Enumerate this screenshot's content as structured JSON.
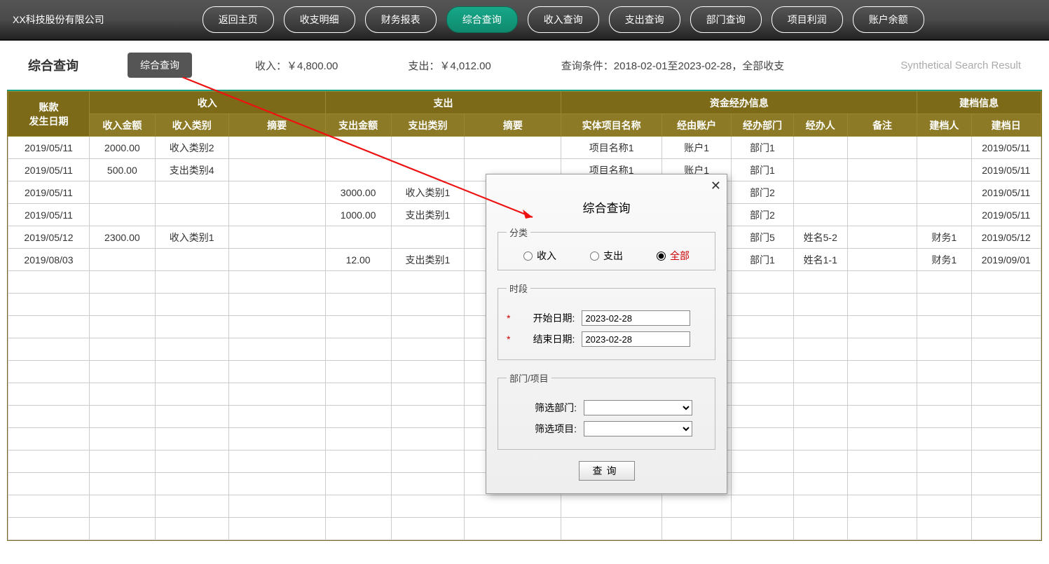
{
  "brand": "XX科技股份有限公司",
  "nav": {
    "items": [
      {
        "label": "返回主页"
      },
      {
        "label": "收支明细"
      },
      {
        "label": "财务报表"
      },
      {
        "label": "综合查询",
        "active": true
      },
      {
        "label": "收入查询"
      },
      {
        "label": "支出查询"
      },
      {
        "label": "部门查询"
      },
      {
        "label": "项目利润"
      },
      {
        "label": "账户余额"
      }
    ]
  },
  "summary": {
    "title": "综合查询",
    "searchBtn": "综合查询",
    "income": "收入：￥4,800.00",
    "expense": "支出：￥4,012.00",
    "condition": "查询条件：2018-02-01至2023-02-28，全部收支",
    "english": "Synthetical Search Result"
  },
  "header": {
    "date": "账款\n发生日期",
    "incomeGrp": "收入",
    "incomeAmt": "收入金额",
    "incomeCat": "收入类别",
    "incomeSum": "摘要",
    "expenseGrp": "支出",
    "expenseAmt": "支出金额",
    "expenseCat": "支出类别",
    "expenseSum": "摘要",
    "fundGrp": "资金经办信息",
    "projName": "实体项目名称",
    "viaAcc": "经由账户",
    "viaDept": "经办部门",
    "viaPerson": "经办人",
    "remark": "备注",
    "createGrp": "建档信息",
    "creator": "建档人",
    "createDate": "建档日"
  },
  "rows": [
    {
      "date": "2019/05/11",
      "inAmt": "2000.00",
      "inCat": "收入类别2",
      "inSum": "",
      "exAmt": "",
      "exCat": "",
      "exSum": "",
      "proj": "项目名称1",
      "acc": "账户1",
      "dept": "部门1",
      "person": "",
      "remark": "",
      "creator": "",
      "cdate": "2019/05/11"
    },
    {
      "date": "2019/05/11",
      "inAmt": "500.00",
      "inCat": "支出类别4",
      "inSum": "",
      "exAmt": "",
      "exCat": "",
      "exSum": "",
      "proj": "项目名称1",
      "acc": "账户1",
      "dept": "部门1",
      "person": "",
      "remark": "",
      "creator": "",
      "cdate": "2019/05/11"
    },
    {
      "date": "2019/05/11",
      "inAmt": "",
      "inCat": "",
      "inSum": "",
      "exAmt": "3000.00",
      "exCat": "收入类别1",
      "exSum": "",
      "proj": "",
      "acc": "",
      "dept": "部门2",
      "person": "",
      "remark": "",
      "creator": "",
      "cdate": "2019/05/11"
    },
    {
      "date": "2019/05/11",
      "inAmt": "",
      "inCat": "",
      "inSum": "",
      "exAmt": "1000.00",
      "exCat": "支出类别1",
      "exSum": "",
      "proj": "",
      "acc": "",
      "dept": "部门2",
      "person": "",
      "remark": "",
      "creator": "",
      "cdate": "2019/05/11"
    },
    {
      "date": "2019/05/12",
      "inAmt": "2300.00",
      "inCat": "收入类别1",
      "inSum": "",
      "exAmt": "",
      "exCat": "",
      "exSum": "",
      "proj": "",
      "acc": "",
      "dept": "部门5",
      "person": "姓名5-2",
      "remark": "",
      "creator": "财务1",
      "cdate": "2019/05/12"
    },
    {
      "date": "2019/08/03",
      "inAmt": "",
      "inCat": "",
      "inSum": "",
      "exAmt": "12.00",
      "exCat": "支出类别1",
      "exSum": "",
      "proj": "",
      "acc": "",
      "dept": "部门1",
      "person": "姓名1-1",
      "remark": "",
      "creator": "财务1",
      "cdate": "2019/09/01"
    }
  ],
  "emptyRowCount": 12,
  "dialog": {
    "title": "综合查询",
    "group1": "分类",
    "opt1": "收入",
    "opt2": "支出",
    "opt3": "全部",
    "group2": "时段",
    "startLbl": "开始日期:",
    "startVal": "2023-02-28",
    "endLbl": "结束日期:",
    "endVal": "2023-02-28",
    "group3": "部门/项目",
    "deptLbl": "筛选部门:",
    "projLbl": "筛选项目:",
    "submit": "查询"
  }
}
